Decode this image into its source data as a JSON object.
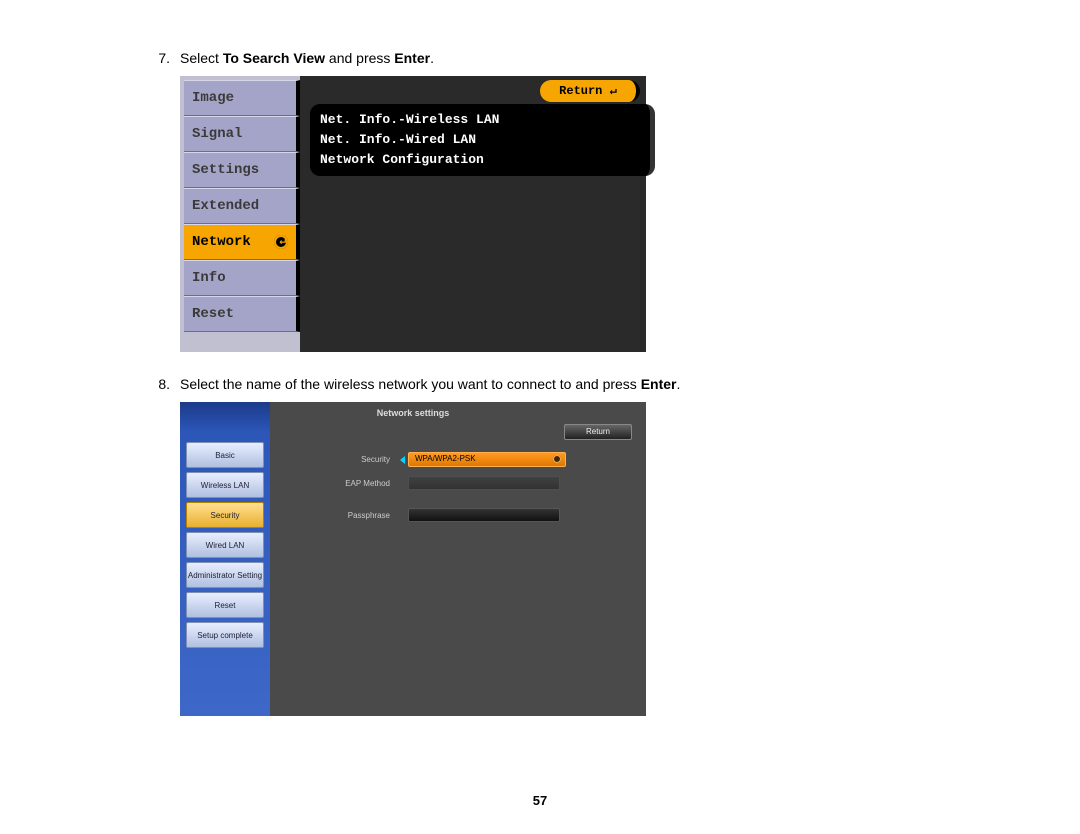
{
  "step7": {
    "number": "7.",
    "pre": "Select ",
    "bold1": "To Search View",
    "mid": " and press ",
    "bold2": "Enter",
    "post": "."
  },
  "step8": {
    "number": "8.",
    "pre": "Select the name of the wireless network you want to connect to and press ",
    "bold1": "Enter",
    "post": "."
  },
  "shot1": {
    "sidebar": [
      "Image",
      "Signal",
      "Settings",
      "Extended",
      "Network",
      "Info",
      "Reset"
    ],
    "active_index": 4,
    "return_label": "Return ↵",
    "panel": [
      "Net. Info.-Wireless LAN",
      "Net. Info.-Wired LAN",
      "Network Configuration"
    ]
  },
  "shot2": {
    "title": "Network settings",
    "return_label": "Return",
    "sidebar": [
      "Basic",
      "Wireless LAN",
      "Security",
      "Wired LAN",
      "Administrator Setting",
      "Reset",
      "Setup complete"
    ],
    "active_index": 2,
    "rows": {
      "security": {
        "label": "Security",
        "value": "WPA/WPA2-PSK"
      },
      "eap": {
        "label": "EAP Method"
      },
      "passphrase": {
        "label": "Passphrase"
      }
    }
  },
  "page_number": "57"
}
